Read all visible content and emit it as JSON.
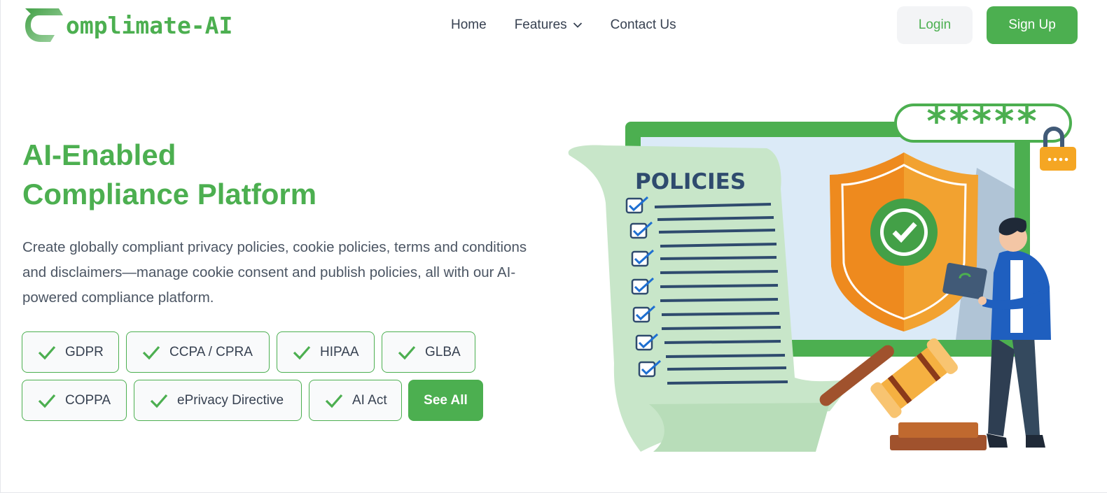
{
  "brand": {
    "logo_text": "omplimate-AI",
    "color": "#4caf50"
  },
  "nav": {
    "home": "Home",
    "features": "Features",
    "contact": "Contact Us"
  },
  "auth": {
    "login": "Login",
    "signup": "Sign Up"
  },
  "hero": {
    "title_line1": "AI-Enabled",
    "title_line2": "Compliance Platform",
    "description": "Create globally compliant privacy policies, cookie policies, terms and conditions and disclaimers—manage cookie consent and publish policies, all with our AI-powered compliance platform."
  },
  "regulations": [
    "GDPR",
    "CCPA / CPRA",
    "HIPAA",
    "GLBA",
    "COPPA",
    "ePrivacy Directive",
    "AI Act"
  ],
  "see_all": "See All",
  "illustration": {
    "policies_heading": "POLICIES",
    "password_mask": "*****"
  },
  "icons": [
    "chevron-down-icon",
    "check-icon",
    "logo-mark-icon",
    "padlock-icon",
    "shield-icon",
    "gavel-icon"
  ]
}
